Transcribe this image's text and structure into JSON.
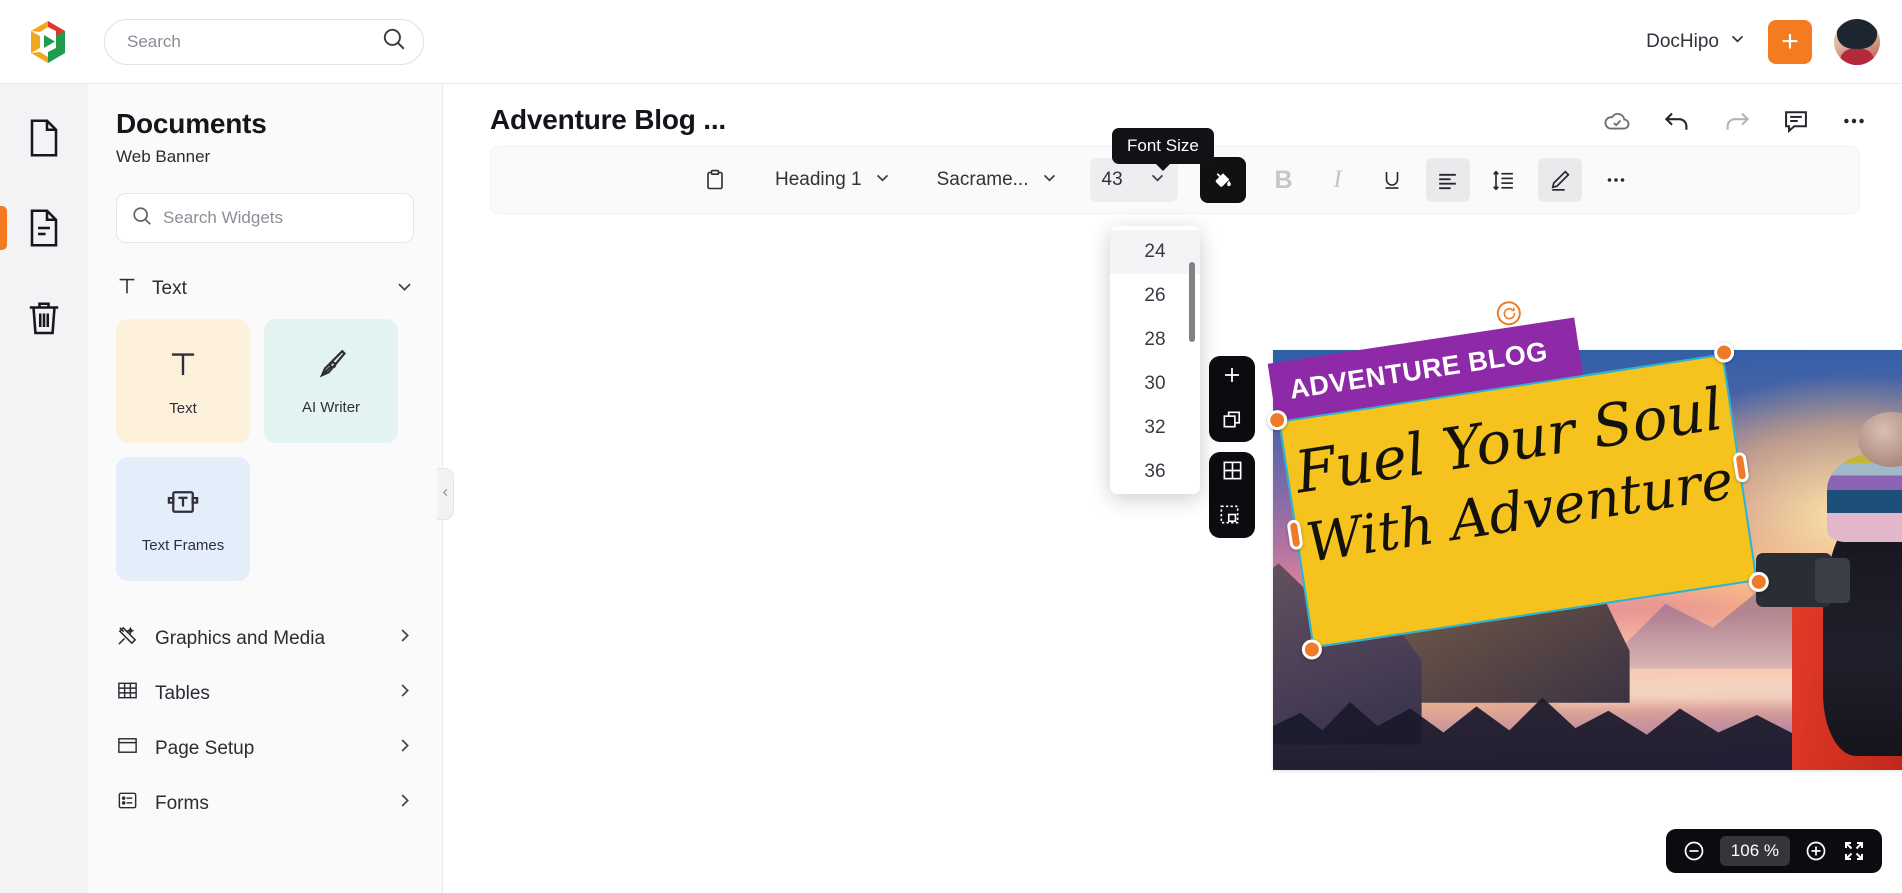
{
  "topbar": {
    "logo_icon": "dochipo-logo-icon",
    "search_placeholder": "Search",
    "search_value": "",
    "search_icon": "search-icon",
    "brand_label": "DocHipo",
    "brand_chevron_icon": "chevron-down-icon",
    "create_button_label": "+",
    "avatar_name": "user-avatar"
  },
  "rail": {
    "items": [
      {
        "icon": "blank-document-icon",
        "name": "rail-item-new-document",
        "active": false
      },
      {
        "icon": "document-lines-icon",
        "name": "rail-item-documents",
        "active": true
      },
      {
        "icon": "trash-icon",
        "name": "rail-item-trash",
        "active": false
      }
    ]
  },
  "panel": {
    "title": "Documents",
    "subtitle": "Web Banner",
    "search_placeholder": "Search Widgets",
    "search_value": "",
    "search_icon": "search-icon",
    "section": {
      "label": "Text",
      "icon": "text-t-icon",
      "chevron": "chevron-down-icon"
    },
    "cards": [
      {
        "label": "Text",
        "icon": "text-t-icon"
      },
      {
        "label": "AI Writer",
        "icon": "pen-nib-icon"
      },
      {
        "label": "Text Frames",
        "icon": "text-frame-icon"
      }
    ],
    "menu": [
      {
        "label": "Graphics and Media",
        "icon": "graphics-media-icon",
        "chevron": "chevron-right-icon"
      },
      {
        "label": "Tables",
        "icon": "table-grid-icon",
        "chevron": "chevron-right-icon"
      },
      {
        "label": "Page Setup",
        "icon": "page-setup-icon",
        "chevron": "chevron-right-icon"
      },
      {
        "label": "Forms",
        "icon": "forms-icon",
        "chevron": "chevron-right-icon"
      }
    ],
    "collapse_icon": "chevron-left-icon"
  },
  "document": {
    "title": "Adventure Blog ...",
    "actions": [
      {
        "name": "cloud-saved-icon",
        "icon": "cloud-check-icon"
      },
      {
        "name": "undo-button",
        "icon": "undo-arrow-icon"
      },
      {
        "name": "redo-button",
        "icon": "redo-arrow-icon"
      },
      {
        "name": "comments-button",
        "icon": "comment-bubble-icon"
      },
      {
        "name": "more-options-button",
        "icon": "ellipsis-icon"
      }
    ]
  },
  "toolbar": {
    "paste_icon": "clipboard-icon",
    "paragraph_style": "Heading 1",
    "font_family": "Sacrame...",
    "font_size": "43",
    "chevron_icon": "chevron-down-icon",
    "buttons": [
      {
        "name": "fill-color-button",
        "icon": "paint-bucket-icon",
        "state": "filled"
      },
      {
        "name": "bold-button",
        "icon": "bold-icon",
        "label": "B",
        "state": "dim"
      },
      {
        "name": "italic-button",
        "icon": "italic-icon",
        "label": "I",
        "state": "dim"
      },
      {
        "name": "underline-button",
        "icon": "underline-icon",
        "label": "U",
        "state": "normal"
      },
      {
        "name": "align-left-button",
        "icon": "align-left-icon",
        "state": "on"
      },
      {
        "name": "line-height-button",
        "icon": "line-height-icon",
        "state": "normal"
      },
      {
        "name": "highlighter-button",
        "icon": "highlighter-pencil-icon",
        "state": "on"
      },
      {
        "name": "more-text-options-button",
        "icon": "ellipsis-icon",
        "state": "normal"
      }
    ]
  },
  "tooltip": {
    "text": "Font Size"
  },
  "font_size_menu": {
    "options": [
      "24",
      "26",
      "28",
      "30",
      "32",
      "36"
    ],
    "hovered": "24"
  },
  "object_toolbars": [
    {
      "name": "object-toolbar-add",
      "icons": [
        "plus-icon",
        "duplicate-icon"
      ]
    },
    {
      "name": "object-toolbar-layout",
      "icons": [
        "grid-icon",
        "crop-selection-icon"
      ]
    }
  ],
  "canvas": {
    "banner": {
      "ribbon_text": "ADVENTURE BLOG",
      "headline_line1": "Fuel Your Soul",
      "headline_line2": "With Adventure",
      "card_color": "#F5C21E",
      "ribbon_color": "#8E2AA8",
      "selection_color": "#26B5D8",
      "handle_color": "#EF7B28",
      "rotate_handle_icon": "rotate-handle-icon"
    }
  },
  "zoom_control": {
    "minus_icon": "zoom-out-icon",
    "level": "106 %",
    "plus_icon": "zoom-in-icon",
    "fullscreen_icon": "fullscreen-expand-icon"
  },
  "colors": {
    "accent": "#F47B20",
    "selection": "#26B5D8",
    "dark_panel": "#0C0C10"
  }
}
